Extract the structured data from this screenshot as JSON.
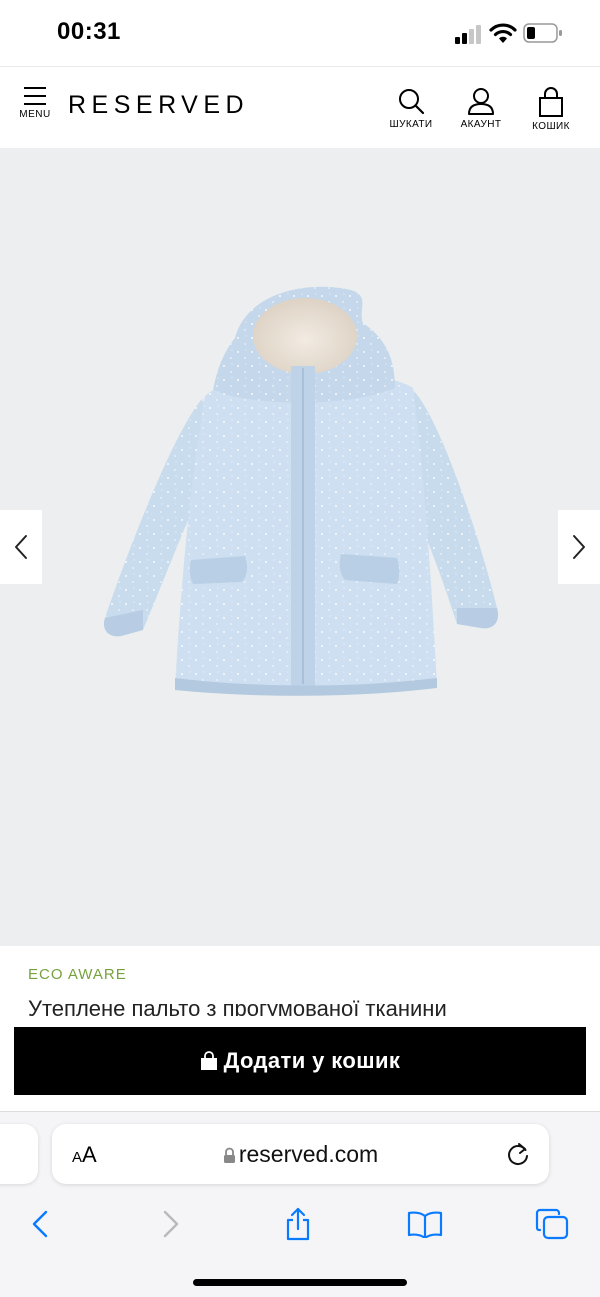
{
  "status_bar": {
    "time": "00:31"
  },
  "header": {
    "menu_label": "MENU",
    "brand": "RESERVED",
    "search_label": "ШУКАТИ",
    "account_label": "АКАУНТ",
    "cart_label": "КОШИК"
  },
  "product": {
    "eco_tag": "ECO AWARE",
    "title": "Утеплене пальто з прогумованої тканини",
    "add_to_cart": "Додати у кошик"
  },
  "browser": {
    "text_size_small": "A",
    "text_size_large": "A",
    "url": "reserved.com"
  },
  "colors": {
    "eco_green": "#76a23d",
    "button_black": "#000000",
    "browser_blue": "#0a7aff",
    "jacket_blue": "#c9dcee"
  },
  "icons": [
    "menu-icon",
    "search-icon",
    "user-icon",
    "bag-icon",
    "chevron-left-icon",
    "chevron-right-icon",
    "lock-icon",
    "reload-icon",
    "share-icon",
    "bookmarks-icon",
    "tabs-icon"
  ]
}
